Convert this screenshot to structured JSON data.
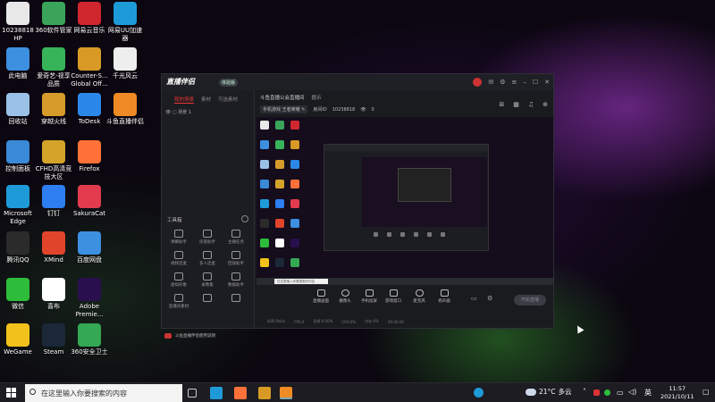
{
  "desktop": {
    "icons": [
      {
        "label": "10238818\nHP",
        "color": "#e8e8e8",
        "icon": "computer-icon"
      },
      {
        "label": "此电脑",
        "color": "#3d8fe0",
        "icon": "monitor-icon"
      },
      {
        "label": "回收站",
        "color": "#9ac2e6",
        "icon": "recycle-bin-icon"
      },
      {
        "label": "控制面板",
        "color": "#3a89d6",
        "icon": "control-panel-icon"
      },
      {
        "label": "Microsoft\nEdge",
        "color": "#1f9ad8",
        "icon": "edge-icon"
      },
      {
        "label": "腾讯QQ",
        "color": "#2b2b2b",
        "icon": "qq-icon"
      },
      {
        "label": "微信",
        "color": "#2ebd3a",
        "icon": "wechat-icon"
      },
      {
        "label": "WeGame",
        "color": "#f1c21b",
        "icon": "wegame-icon"
      },
      {
        "label": "360软件管家",
        "color": "#3aa55a",
        "icon": "360-software-icon"
      },
      {
        "label": "爱奇艺-视享\n品质",
        "color": "#37b35a",
        "icon": "iqiyi-icon"
      },
      {
        "label": "穿越火线",
        "color": "#d69b2a",
        "icon": "crossfire-icon"
      },
      {
        "label": "CFHD高清竞\n技大区",
        "color": "#d4a42a",
        "icon": "cfhd-icon"
      },
      {
        "label": "钉钉",
        "color": "#2d7ef0",
        "icon": "dingtalk-icon"
      },
      {
        "label": "XMind",
        "color": "#e0452b",
        "icon": "xmind-icon"
      },
      {
        "label": "喜布",
        "color": "#ffffff",
        "icon": "xibu-icon"
      },
      {
        "label": "Steam",
        "color": "#1b2838",
        "icon": "steam-icon"
      },
      {
        "label": "网易云音乐",
        "color": "#d0262d",
        "icon": "netease-music-icon"
      },
      {
        "label": "Counter-S...\nGlobal Off...",
        "color": "#d89a24",
        "icon": "csgo-icon"
      },
      {
        "label": "ToDesk",
        "color": "#2b88e8",
        "icon": "todesk-icon"
      },
      {
        "label": "Firefox",
        "color": "#ff7139",
        "icon": "firefox-icon"
      },
      {
        "label": "SakuraCat",
        "color": "#e23b4e",
        "icon": "sakuracat-icon"
      },
      {
        "label": "百度网盘",
        "color": "#3d8fe0",
        "icon": "baidu-netdisk-icon"
      },
      {
        "label": "Adobe\nPremie...",
        "color": "#2a0f4e",
        "icon": "premiere-icon"
      },
      {
        "label": "360安全卫士",
        "color": "#34a853",
        "icon": "360-safe-icon"
      },
      {
        "label": "网易UU加速\n器",
        "color": "#1d9bd8",
        "icon": "uu-accelerator-icon"
      },
      {
        "label": "千光风云",
        "color": "#eeeeee",
        "icon": "game-icon"
      },
      {
        "label": "斗鱼直播伴侣",
        "color": "#f08a24",
        "icon": "douyu-icon"
      }
    ]
  },
  "app": {
    "title": "直播伴侣",
    "beta_badge": "体验版",
    "sidebar_tabs": [
      "我的场景",
      "素材",
      "可选素材"
    ],
    "scene_name": "场景 1",
    "tools_title": "工具箱",
    "tools": [
      "弹幕助手",
      "房管助手",
      "主播任务",
      "视频连麦",
      "多人连麦",
      "回放助手",
      "虚拟形象",
      "录像集",
      "数据助手",
      "直播间素材",
      "",
      ""
    ],
    "sidebar_footer": "斗鱼直播伴侣使用说明",
    "main_tabs": [
      "斗鱼直播公会直播间",
      "提示"
    ],
    "room_info": {
      "category": "手机游戏",
      "subcategory": "王者荣耀",
      "room_label": "房间ID",
      "room_id": "10238818",
      "viewers_icon": "👁",
      "viewers": "0"
    },
    "controls": [
      "直播画面",
      "摄像头",
      "手机投屏",
      "游戏窗口",
      "麦克风",
      "扬声器"
    ],
    "go_live": "开始直播",
    "status": [
      "码率:0kb/s",
      "FPS:0",
      "丢帧:0.00%",
      "CPU:0%",
      "内存:0%",
      "00:00:00"
    ]
  },
  "taskbar": {
    "search_placeholder": "在这里输入你要搜索的内容",
    "apps": [
      {
        "icon": "task-view-icon",
        "color": "#cccccc"
      },
      {
        "icon": "edge-icon",
        "color": "#1f9ad8"
      },
      {
        "icon": "firefox-icon",
        "color": "#ff7139"
      },
      {
        "icon": "csgo-icon",
        "color": "#d89a24"
      },
      {
        "icon": "douyu-icon",
        "color": "#f08a24"
      }
    ],
    "weather": {
      "temp": "21°C",
      "desc": "多云"
    },
    "time": "11:57",
    "date": "2021/10/11"
  }
}
